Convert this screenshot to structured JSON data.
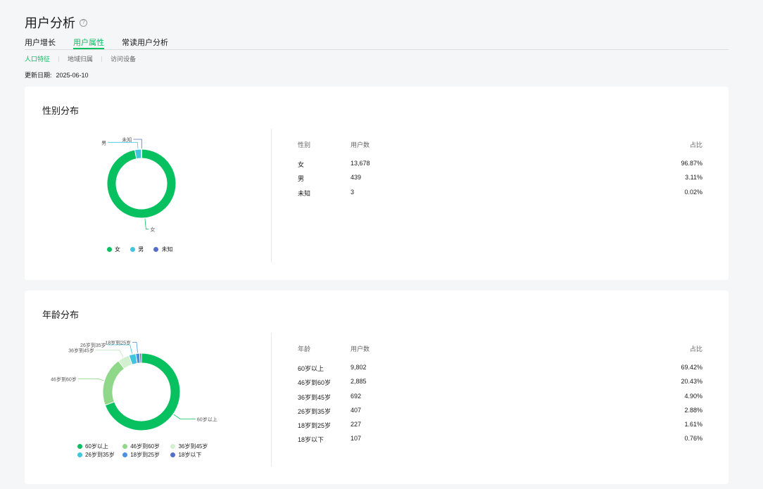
{
  "header": {
    "title": "用户分析",
    "help_icon": "question-circle-icon"
  },
  "tabs": [
    {
      "label": "用户增长",
      "active": false
    },
    {
      "label": "用户属性",
      "active": true
    },
    {
      "label": "常读用户分析",
      "active": false
    }
  ],
  "subtabs": [
    {
      "label": "人口特征",
      "active": true
    },
    {
      "label": "地域归属",
      "active": false
    },
    {
      "label": "访问设备",
      "active": false
    }
  ],
  "update": {
    "label": "更新日期:",
    "value": "2025-06-10"
  },
  "colors": {
    "accent": "#07c160"
  },
  "gender": {
    "title": "性别分布",
    "columns": [
      "性别",
      "用户数",
      "占比"
    ],
    "rows": [
      {
        "name": "女",
        "count": "13,678",
        "pct": "96.87%"
      },
      {
        "name": "男",
        "count": "439",
        "pct": "3.11%"
      },
      {
        "name": "未知",
        "count": "3",
        "pct": "0.02%"
      }
    ]
  },
  "age": {
    "title": "年龄分布",
    "columns": [
      "年龄",
      "用户数",
      "占比"
    ],
    "rows": [
      {
        "name": "60岁以上",
        "count": "9,802",
        "pct": "69.42%"
      },
      {
        "name": "46岁到60岁",
        "count": "2,885",
        "pct": "20.43%"
      },
      {
        "name": "36岁到45岁",
        "count": "692",
        "pct": "4.90%"
      },
      {
        "name": "26岁到35岁",
        "count": "407",
        "pct": "2.88%"
      },
      {
        "name": "18岁到25岁",
        "count": "227",
        "pct": "1.61%"
      },
      {
        "name": "18岁以下",
        "count": "107",
        "pct": "0.76%"
      }
    ]
  },
  "chart_data": [
    {
      "type": "pie",
      "categories": [
        "女",
        "男",
        "未知"
      ],
      "values": [
        96.87,
        3.11,
        0.02
      ],
      "colors": [
        "#07c160",
        "#3fc6dd",
        "#5470c6"
      ],
      "legend": "bottom"
    },
    {
      "type": "pie",
      "categories": [
        "60岁以上",
        "46岁到60岁",
        "36岁到45岁",
        "26岁到35岁",
        "18岁到25岁",
        "18岁以下"
      ],
      "values": [
        69.42,
        20.43,
        4.9,
        2.88,
        1.61,
        0.76
      ],
      "colors": [
        "#07c160",
        "#8fd889",
        "#d2f0d0",
        "#3fc6dd",
        "#4a90e2",
        "#5470c6"
      ],
      "legend": "bottom"
    }
  ]
}
